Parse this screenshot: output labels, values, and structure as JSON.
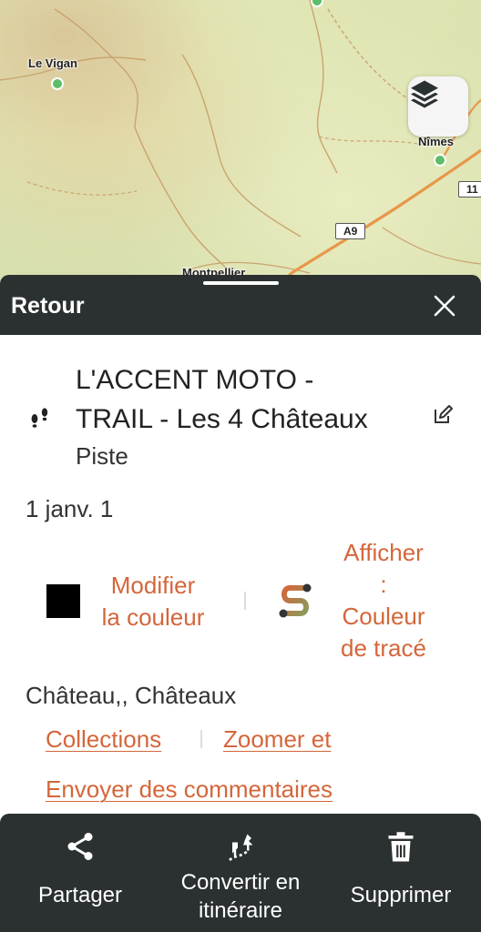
{
  "map": {
    "cities": [
      {
        "name": "Le Vigan"
      },
      {
        "name": "Nîmes"
      },
      {
        "name": "Montpellier"
      }
    ],
    "road_shields": [
      "A9",
      "11"
    ],
    "layers_button_icon": "layers-icon"
  },
  "sheet": {
    "back_label": "Retour",
    "close_icon": "close-icon"
  },
  "track": {
    "icon": "footsteps-icon",
    "title_line1": "L'ACCENT MOTO -",
    "title_line2": "TRAIL - Les 4 Châteaux",
    "type": "Piste",
    "date": "1 janv. 1",
    "color_swatch": "#000000",
    "modify_color_line1": "Modifier",
    "modify_color_line2": "la couleur",
    "show_color_line1": "Afficher",
    "show_color_line2": ":",
    "show_color_line3": "Couleur",
    "show_color_line4": "de tracé",
    "categories": "Château,, Châteaux"
  },
  "links": {
    "collections": "Collections",
    "zoom": "Zoomer et",
    "feedback": "Envoyer des commentaires"
  },
  "bottom_bar": {
    "share_label": "Partager",
    "convert_line1": "Convertir en",
    "convert_line2": "itinéraire",
    "delete_label": "Supprimer"
  },
  "colors": {
    "accent": "#d4663a",
    "dark_bar": "#2b3031",
    "city_dot": "#5dbd6a",
    "road_major": "#e8974a",
    "road_minor": "#d9a06a"
  }
}
